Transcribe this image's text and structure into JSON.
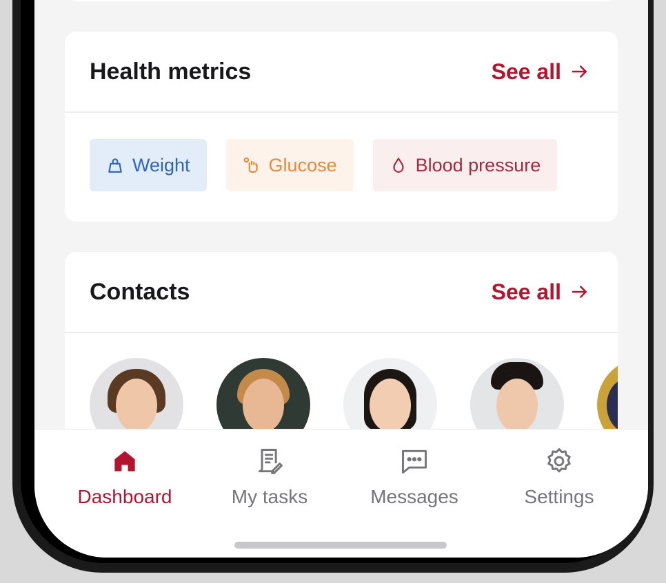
{
  "colors": {
    "accent": "#b3142f",
    "weight": "#2e65b8",
    "glucose": "#e68a3c",
    "blood_pressure": "#a52a3d"
  },
  "health_metrics": {
    "title": "Health metrics",
    "see_all": "See all",
    "chips": [
      {
        "label": "Weight",
        "icon": "weight-icon"
      },
      {
        "label": "Glucose",
        "icon": "glucose-icon"
      },
      {
        "label": "Blood pressure",
        "icon": "blood-drop-icon"
      }
    ]
  },
  "contacts": {
    "title": "Contacts",
    "see_all": "See all"
  },
  "tabs": [
    {
      "label": "Dashboard",
      "icon": "home-icon",
      "active": true
    },
    {
      "label": "My tasks",
      "icon": "tasks-icon",
      "active": false
    },
    {
      "label": "Messages",
      "icon": "message-icon",
      "active": false
    },
    {
      "label": "Settings",
      "icon": "gear-icon",
      "active": false
    }
  ]
}
